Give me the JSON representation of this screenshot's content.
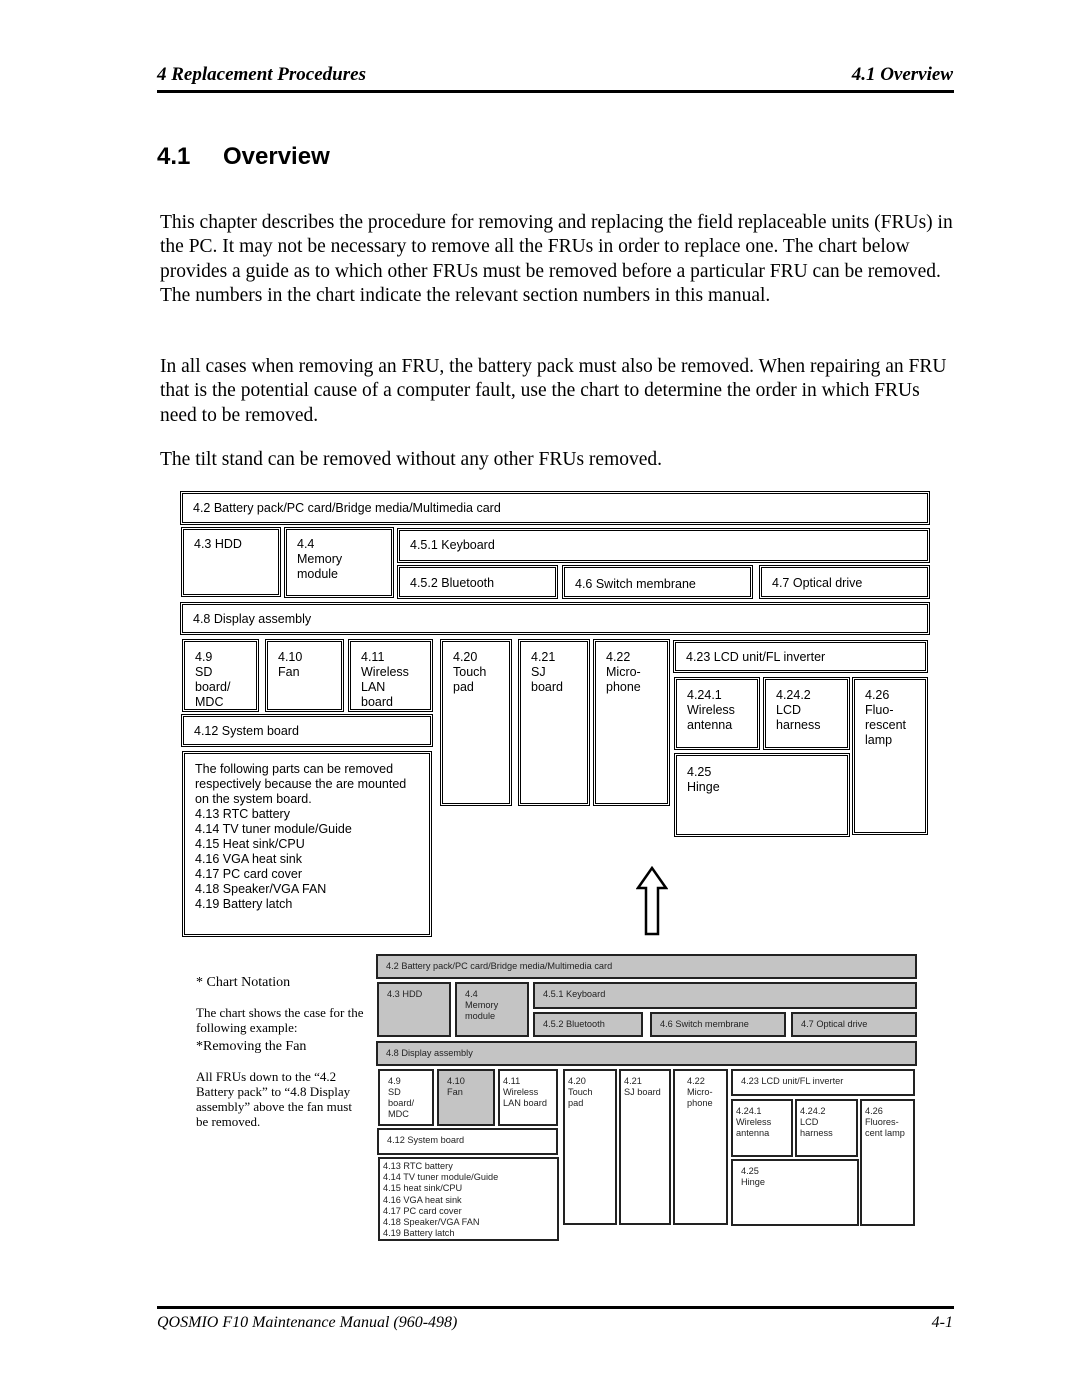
{
  "header": {
    "chapter": "4  Replacement Procedures",
    "section": "4.1  Overview"
  },
  "title": {
    "number": "4.1",
    "text": "Overview"
  },
  "paragraphs": [
    "This chapter describes the procedure for removing and replacing the field replaceable units (FRUs) in the PC. It may not be necessary to remove all the FRUs in order to replace one. The chart below provides a guide as to which other FRUs must be removed before a particular FRU can be removed. The numbers in the chart indicate the relevant section numbers in this manual.",
    "In all cases when removing an FRU, the battery pack must also be removed. When repairing an FRU that is the potential cause of a computer fault, use the chart to determine the order in which FRUs need to be removed.",
    "The tilt stand can be removed without any other FRUs removed."
  ],
  "chart": {
    "b42": "4.2 Battery pack/PC card/Bridge media/Multimedia card",
    "b43": "4.3 HDD",
    "b44": "4.4\nMemory\nmodule",
    "b451": "4.5.1 Keyboard",
    "b452": "4.5.2 Bluetooth",
    "b46": "4.6 Switch membrane",
    "b47": "4.7 Optical drive",
    "b48": "4.8 Display assembly",
    "b49": "4.9\nSD\nboard/\nMDC",
    "b410": "4.10\nFan",
    "b411": "4.11\nWireless\nLAN\nboard",
    "b420": "4.20\nTouch\npad",
    "b421": "4.21\nSJ\nboard",
    "b422": "4.22\nMicro-\nphone",
    "b423": "4.23 LCD unit/FL inverter",
    "b4241": "4.24.1\nWireless\nantenna",
    "b4242": "4.24.2\nLCD\nharness",
    "b426": "4.26\nFluo-\nrescent\nlamp",
    "b412": "4.12 System board",
    "b425": "4.25\nHinge",
    "mounted": "The following parts can be removed\nrespectively because the are mounted\non the system board.\n4.13 RTC battery\n4.14 TV tuner module/Guide\n4.15 Heat sink/CPU\n4.16 VGA heat sink\n4.17 PC card cover\n4.18 Speaker/VGA FAN\n4.19 Battery latch"
  },
  "notation": {
    "heading": "* Chart Notation",
    "text": "The chart shows the case for the following example:",
    "example_heading": "*Removing the Fan",
    "example_text": "All FRUs down to the “4.2 Battery pack” to “4.8 Display assembly” above the fan must be removed."
  },
  "example_chart": {
    "highlight_color": "#c4c4c4",
    "b42": "4.2 Battery pack/PC card/Bridge media/Multimedia card",
    "b43": "4.3 HDD",
    "b44": "4.4\nMemory\nmodule",
    "b451": "4.5.1 Keyboard",
    "b452": "4.5.2 Bluetooth",
    "b46": "4.6 Switch membrane",
    "b47": "4.7 Optical drive",
    "b48": "4.8 Display assembly",
    "b49": "4.9\nSD\nboard/\nMDC",
    "b410": "4.10\nFan",
    "b411": "4.11\nWireless\nLAN board",
    "b420": "4.20\nTouch\npad",
    "b421": "4.21\nSJ board",
    "b422": "4.22\nMicro-\nphone",
    "b423": "4.23 LCD unit/FL inverter",
    "b4241": "4.24.1\nWireless\nantenna",
    "b4242": "4.24.2\nLCD\nharness",
    "b426": "4.26\nFluores-\ncent lamp",
    "b412": "4.12 System board",
    "b425": "4.25\nHinge",
    "mounted": "4.13 RTC battery\n4.14 TV tuner module/Guide\n4.15 heat sink/CPU\n4.16 VGA heat sink\n4.17 PC card cover\n4.18 Speaker/VGA FAN\n4.19 Battery latch"
  },
  "footer": {
    "manual": "QOSMIO F10  Maintenance Manual (960-498)",
    "page": "4-1"
  }
}
